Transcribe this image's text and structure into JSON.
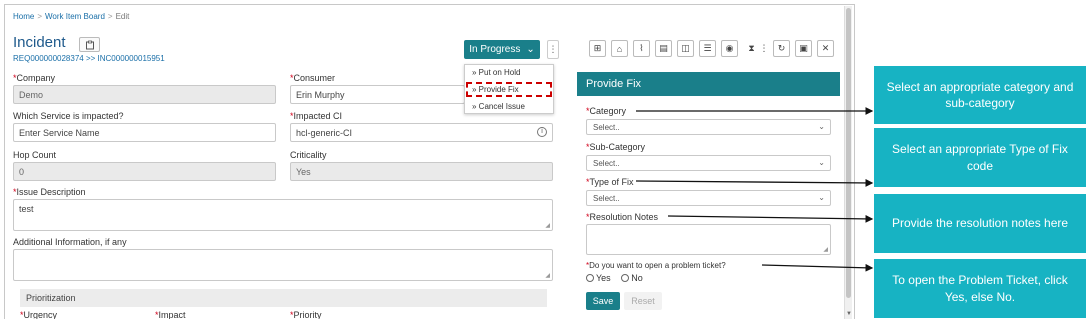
{
  "breadcrumb": {
    "home": "Home",
    "board": "Work Item Board",
    "current": "Edit",
    "sep": ">"
  },
  "header": {
    "title": "Incident",
    "ref_text": "REQ000000028374 >> INC000000015951",
    "status": "In Progress",
    "status_menu": [
      "» Put on Hold",
      "» Provide Fix",
      "» Cancel Issue"
    ]
  },
  "form": {
    "company_label": "Company",
    "company_value": "Demo",
    "consumer_label": "Consumer",
    "consumer_value": "Erin Murphy",
    "service_label": "Which Service is impacted?",
    "service_placeholder": "Enter Service Name",
    "ci_label": "Impacted CI",
    "ci_value": "hcl-generic-CI",
    "hop_label": "Hop Count",
    "hop_value": "0",
    "criticality_label": "Criticality",
    "criticality_value": "Yes",
    "issue_label": "Issue Description",
    "issue_value": "test",
    "additional_label": "Additional Information, if any",
    "prioritization_label": "Prioritization",
    "urgency_label": "Urgency",
    "impact_label": "Impact",
    "priority_label": "Priority"
  },
  "panel": {
    "title": "Provide Fix",
    "category_label": "Category",
    "category_value": "Select..",
    "subcategory_label": "Sub-Category",
    "subcategory_value": "Select..",
    "fixtype_label": "Type of Fix",
    "fixtype_value": "Select..",
    "notes_label": "Resolution Notes",
    "problem_label": "Do you want to open a problem ticket?",
    "yes_label": "Yes",
    "no_label": "No",
    "save_label": "Save",
    "reset_label": "Reset"
  },
  "callouts": [
    "Select an appropriate category and sub-category",
    "Select an appropriate Type of Fix code",
    "Provide the resolution notes here",
    "To open the Problem Ticket, click Yes, else No."
  ],
  "colors": {
    "primary": "#1a7f8a",
    "callout": "#17b3c3",
    "link": "#1a6fa8",
    "required": "#d0021b",
    "highlight": "#cc0000"
  }
}
